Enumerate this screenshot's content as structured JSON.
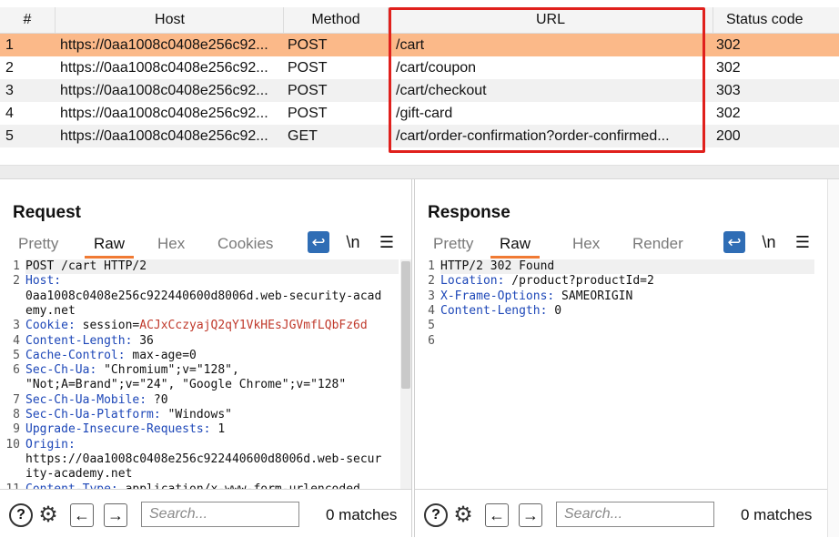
{
  "history": {
    "columns": [
      "#",
      "Host",
      "Method",
      "URL",
      "Status code"
    ],
    "rows": [
      {
        "num": "1",
        "host": "https://0aa1008c0408e256c92...",
        "method": "POST",
        "url": "/cart",
        "status": "302"
      },
      {
        "num": "2",
        "host": "https://0aa1008c0408e256c92...",
        "method": "POST",
        "url": "/cart/coupon",
        "status": "302"
      },
      {
        "num": "3",
        "host": "https://0aa1008c0408e256c92...",
        "method": "POST",
        "url": "/cart/checkout",
        "status": "303"
      },
      {
        "num": "4",
        "host": "https://0aa1008c0408e256c92...",
        "method": "POST",
        "url": "/gift-card",
        "status": "302"
      },
      {
        "num": "5",
        "host": "https://0aa1008c0408e256c92...",
        "method": "GET",
        "url": "/cart/order-confirmation?order-confirmed...",
        "status": "200"
      }
    ],
    "selected_row": 1,
    "highlight_color": "#e0201c",
    "selected_color": "#fbb989"
  },
  "request": {
    "title": "Request",
    "tabs": [
      "Pretty",
      "Raw",
      "Hex",
      "Cookies"
    ],
    "active_tab": "Raw",
    "icons": [
      "wrap-icon",
      "newline-icon",
      "menu-icon"
    ],
    "newline_label": "\\n",
    "lines": [
      {
        "n": "1",
        "text": "POST /cart HTTP/2"
      },
      {
        "n": "2",
        "key": "Host:",
        "text": ""
      },
      {
        "n": "",
        "text": "0aa1008c0408e256c922440600d8006d.web-security-acad"
      },
      {
        "n": "",
        "text": "emy.net"
      },
      {
        "n": "3",
        "key": "Cookie:",
        "text": " session=",
        "val": "ACJxCczyajQ2qY1VkHEsJGVmfLQbFz6d"
      },
      {
        "n": "4",
        "key": "Content-Length:",
        "text": " 36"
      },
      {
        "n": "5",
        "key": "Cache-Control:",
        "text": " max-age=0"
      },
      {
        "n": "6",
        "key": "Sec-Ch-Ua:",
        "text": " \"Chromium\";v=\"128\","
      },
      {
        "n": "",
        "text": "\"Not;A=Brand\";v=\"24\", \"Google Chrome\";v=\"128\""
      },
      {
        "n": "7",
        "key": "Sec-Ch-Ua-Mobile:",
        "text": " ?0"
      },
      {
        "n": "8",
        "key": "Sec-Ch-Ua-Platform:",
        "text": " \"Windows\""
      },
      {
        "n": "9",
        "key": "Upgrade-Insecure-Requests:",
        "text": " 1"
      },
      {
        "n": "10",
        "key": "Origin:",
        "text": ""
      },
      {
        "n": "",
        "text": "https://0aa1008c0408e256c922440600d8006d.web-secur"
      },
      {
        "n": "",
        "text": "ity-academy.net"
      },
      {
        "n": "11",
        "key": "Content-Type:",
        "text": " application/x-www-form-urlencoded"
      }
    ],
    "search_placeholder": "Search...",
    "matches": "0 matches"
  },
  "response": {
    "title": "Response",
    "tabs": [
      "Pretty",
      "Raw",
      "Hex",
      "Render"
    ],
    "active_tab": "Raw",
    "icons": [
      "wrap-icon",
      "newline-icon",
      "menu-icon"
    ],
    "newline_label": "\\n",
    "lines": [
      {
        "n": "1",
        "text": "HTTP/2 302 Found"
      },
      {
        "n": "2",
        "key": "Location:",
        "text": " /product?productId=2"
      },
      {
        "n": "3",
        "key": "X-Frame-Options:",
        "text": " SAMEORIGIN"
      },
      {
        "n": "4",
        "key": "Content-Length:",
        "text": " 0"
      },
      {
        "n": "5",
        "text": ""
      },
      {
        "n": "6",
        "text": ""
      }
    ],
    "search_placeholder": "Search...",
    "matches": "0 matches"
  },
  "accent_color": "#2f6db5",
  "tab_underline_color": "#f07a33"
}
